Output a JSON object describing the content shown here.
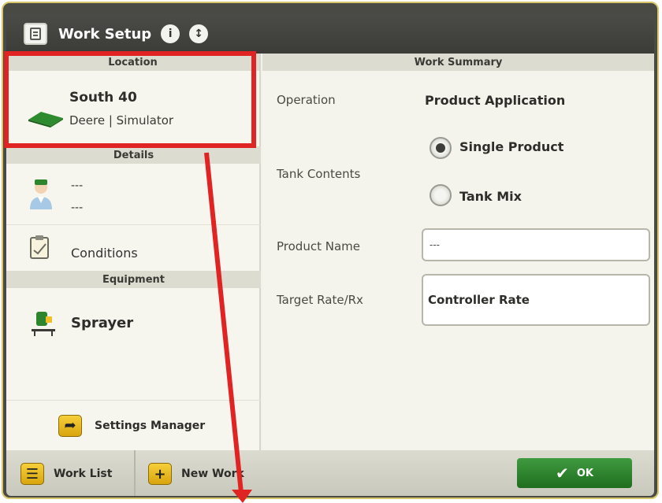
{
  "window": {
    "title": "Work Setup"
  },
  "title_buttons": [
    {
      "glyph": "i"
    },
    {
      "glyph": "↕"
    }
  ],
  "left_panel": {
    "location_header": "Location",
    "location": {
      "name": "South 40",
      "subtitle": "Deere | Simulator",
      "icon": "field-icon"
    },
    "details_header": "Details",
    "details": {
      "line1": "---",
      "line2": "---",
      "icon": "operator-icon"
    },
    "conditions": {
      "label": "Conditions",
      "icon": "clipboard-icon"
    },
    "equipment_header": "Equipment",
    "equipment": {
      "label": "Sprayer",
      "icon": "sprayer-icon"
    },
    "settings_manager": {
      "label": "Settings Manager",
      "icon": "arrow-curve-icon"
    }
  },
  "right_panel": {
    "header": "Work Summary",
    "operation": {
      "label": "Operation",
      "value": "Product Application"
    },
    "tank_contents": {
      "label": "Tank Contents",
      "options": [
        {
          "label": "Single Product",
          "selected": true
        },
        {
          "label": "Tank Mix",
          "selected": false
        }
      ]
    },
    "product_name": {
      "label": "Product Name",
      "value": "---"
    },
    "target_rate": {
      "label": "Target Rate/Rx",
      "value": "Controller Rate"
    }
  },
  "bottom_bar": {
    "work_list": "Work List",
    "new_work": "New Work",
    "ok": "OK"
  },
  "colors": {
    "accent_green": "#2e852e",
    "highlight_red": "#e02323",
    "button_gold": "#f0c02a"
  }
}
